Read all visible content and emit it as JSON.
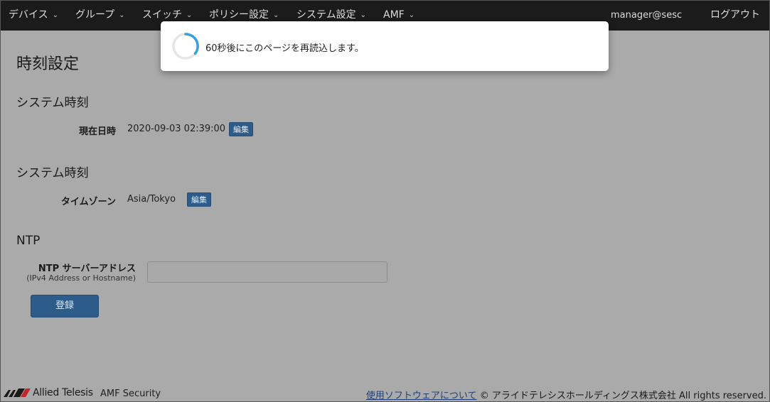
{
  "nav": {
    "items": [
      {
        "label": "デバイス"
      },
      {
        "label": "グループ"
      },
      {
        "label": "スイッチ"
      },
      {
        "label": "ポリシー設定"
      },
      {
        "label": "システム設定"
      },
      {
        "label": "AMF"
      }
    ],
    "user": "manager@sesc",
    "logout": "ログアウト",
    "chevron": "⌄"
  },
  "page": {
    "title": "時刻設定",
    "system_time": {
      "heading": "システム時刻",
      "label": "現在日時",
      "value": "2020-09-03 02:39:00",
      "edit": "編集"
    },
    "timezone": {
      "heading": "システム時刻",
      "label": "タイムゾーン",
      "value": "Asia/Tokyo",
      "edit": "編集"
    },
    "ntp": {
      "heading": "NTP",
      "label": "NTP サーバーアドレス",
      "sublabel": "(IPv4 Address or Hostname)",
      "value": "",
      "register": "登録"
    }
  },
  "modal": {
    "message": "60秒後にこのページを再読込します。"
  },
  "footer": {
    "brand": "Allied Telesis",
    "product": "AMF Security",
    "link": "使用ソフトウェアについて",
    "copyright": "© アライドテレシスホールディングス株式会社 All rights reserved."
  },
  "colors": {
    "navbar": "#1b1b1b",
    "overlay": "#aaaaaa",
    "button": "#2d5b8a",
    "spinner_accent": "#3aa0dc"
  }
}
